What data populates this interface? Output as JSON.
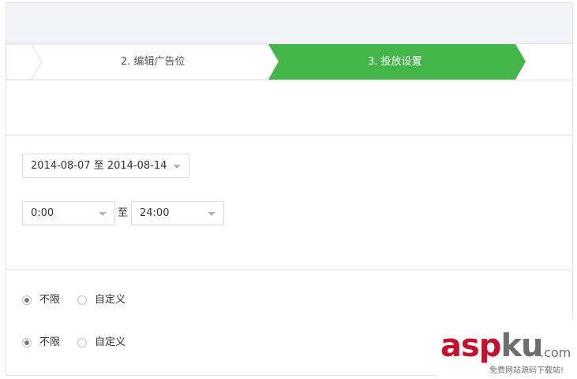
{
  "steps": {
    "step2_label": "2. 编辑广告位",
    "step3_label": "3. 投放设置",
    "active_color": "#44b549"
  },
  "date_range": {
    "value": "2014-08-07 至 2014-08-14"
  },
  "time_range": {
    "start": "0:00",
    "separator": "至",
    "end": "24:00"
  },
  "option_group_1": {
    "unlimited_label": "不限",
    "custom_label": "自定义",
    "selected": "unlimited"
  },
  "option_group_2": {
    "unlimited_label": "不限",
    "custom_label": "自定义",
    "selected": "unlimited"
  },
  "watermark": {
    "brand_red": "asp",
    "brand_grey": "ku",
    "domain": ".com",
    "tagline": "免费网站源码下载站!"
  }
}
